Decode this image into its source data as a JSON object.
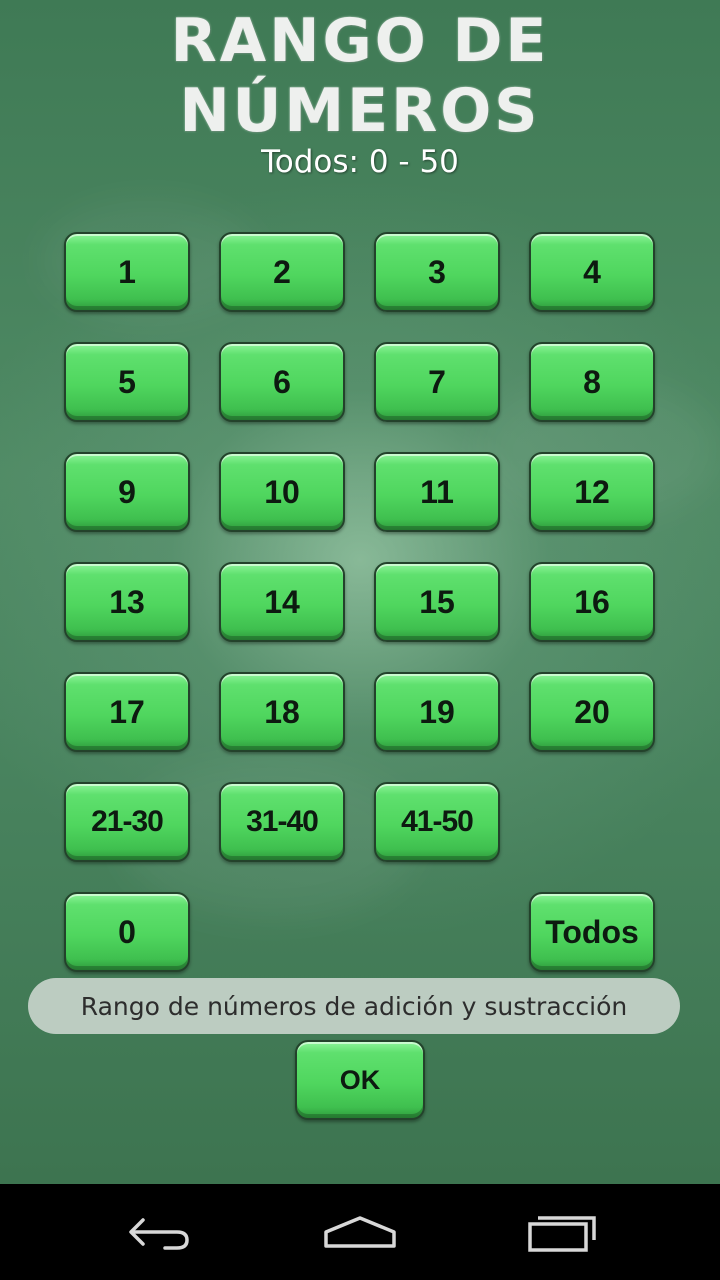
{
  "header": {
    "title": "Rango de números",
    "range_display": "Todos: 0 - 50"
  },
  "number_buttons": [
    {
      "label": "1"
    },
    {
      "label": "2"
    },
    {
      "label": "3"
    },
    {
      "label": "4"
    },
    {
      "label": "5"
    },
    {
      "label": "6"
    },
    {
      "label": "7"
    },
    {
      "label": "8"
    },
    {
      "label": "9"
    },
    {
      "label": "10"
    },
    {
      "label": "11"
    },
    {
      "label": "12"
    },
    {
      "label": "13"
    },
    {
      "label": "14"
    },
    {
      "label": "15"
    },
    {
      "label": "16"
    },
    {
      "label": "17"
    },
    {
      "label": "18"
    },
    {
      "label": "19"
    },
    {
      "label": "20"
    }
  ],
  "range_buttons": [
    {
      "label": "21-30"
    },
    {
      "label": "31-40"
    },
    {
      "label": "41-50"
    }
  ],
  "zero_button": {
    "label": "0"
  },
  "all_button": {
    "label": "Todos"
  },
  "toast": {
    "text": "Rango de números de adición y sustracción"
  },
  "ok_button": {
    "label": "OK"
  },
  "nav": {
    "back_icon": "back-arrow-icon",
    "home_icon": "home-icon",
    "recents_icon": "recent-apps-icon"
  },
  "colors": {
    "button_green": "#4fd65e",
    "board_green": "#4a8560"
  }
}
